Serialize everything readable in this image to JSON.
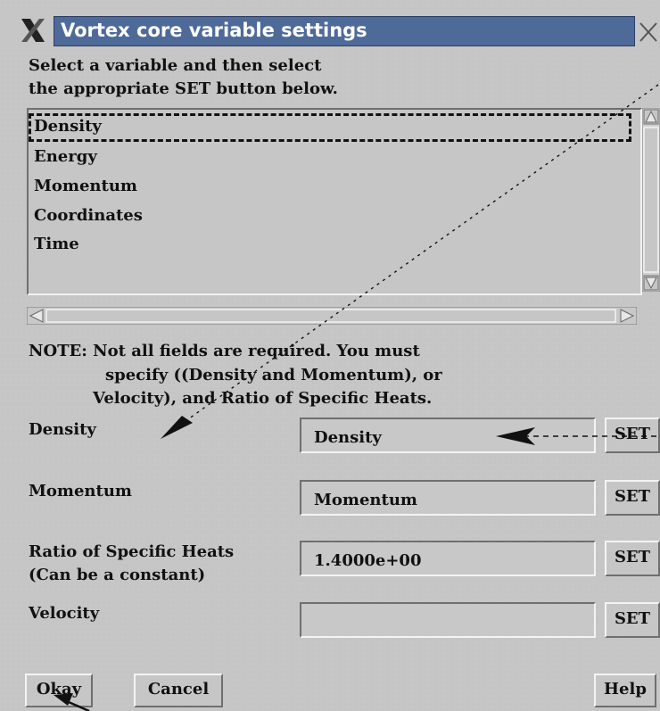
{
  "window": {
    "title": "Vortex core variable settings"
  },
  "instructions": {
    "line1": "Select a variable and then select",
    "line2": "the appropriate SET button below."
  },
  "variables": [
    "Density",
    "Energy",
    "Momentum",
    "Coordinates",
    "Time"
  ],
  "selected_variable": "Density",
  "note": {
    "line1": "NOTE: Not all fields are required.  You must",
    "line2": "specify ((Density and Momentum), or",
    "line3": "Velocity), and Ratio of Specific Heats."
  },
  "fields": [
    {
      "label": "Density",
      "label2": "",
      "value": "Density",
      "button": "SET"
    },
    {
      "label": "Momentum",
      "label2": "",
      "value": "Momentum",
      "button": "SET"
    },
    {
      "label": "Ratio of Specific Heats",
      "label2": "(Can be a constant)",
      "value": "1.4000e+00",
      "button": "SET"
    },
    {
      "label": "Velocity",
      "label2": "",
      "value": "",
      "button": "SET"
    }
  ],
  "buttons": {
    "okay": "Okay",
    "cancel": "Cancel",
    "help": "Help"
  },
  "colors": {
    "window_bg": "#c6c6c6",
    "title_bar": "#4e6a98"
  }
}
